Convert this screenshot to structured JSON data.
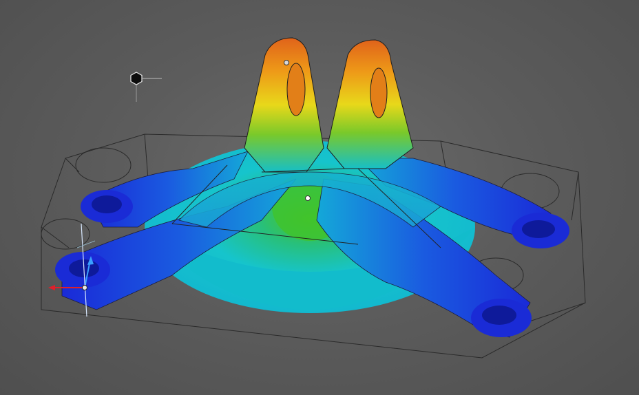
{
  "viewport": {
    "mode": "3d-viewport",
    "shading": "stress-heatmap",
    "background_color": "#5a5a5a"
  },
  "heatmap": {
    "low_color": "#1f2fd8",
    "mid_low_color": "#14c3cf",
    "mid_color": "#3cc53a",
    "mid_high_color": "#f0e11a",
    "high_color": "#e0631a"
  },
  "gizmo": {
    "x_axis_color": "#e0202a",
    "y_axis_color": "#3aa0ff",
    "z_axis_color": "#d8e8ff"
  },
  "icons": {
    "light": "hexagon-light-icon",
    "pivot": "pivot-point-icon"
  }
}
